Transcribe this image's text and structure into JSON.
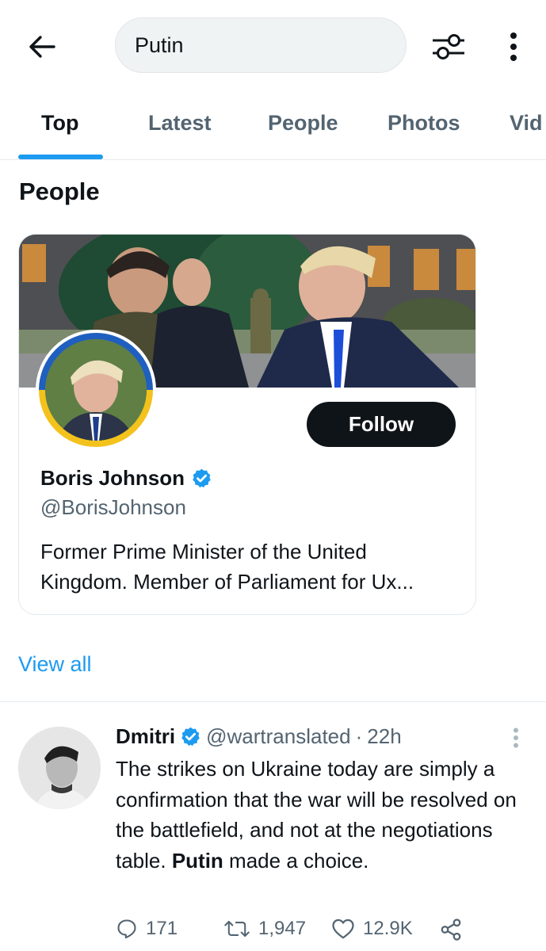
{
  "search": {
    "query": "Putin"
  },
  "tabs": [
    {
      "label": "Top",
      "active": true
    },
    {
      "label": "Latest"
    },
    {
      "label": "People"
    },
    {
      "label": "Photos"
    },
    {
      "label": "Vid"
    }
  ],
  "people_section": {
    "title": "People",
    "view_all": "View all",
    "card": {
      "name": "Boris Johnson",
      "verified": true,
      "handle": "@BorisJohnson",
      "bio_line1": "Former Prime Minister of the United",
      "bio_line2": "Kingdom. Member of Parliament for Ux...",
      "follow_label": "Follow"
    }
  },
  "tweet": {
    "name": "Dmitri",
    "verified": true,
    "handle": "@wartranslated",
    "separator": "·",
    "time": "22h",
    "text_before": "The strikes on Ukraine today are simply a confirmation that the war will be resolved on the battlefield, and not at the negotiations table. ",
    "text_bold": "Putin",
    "text_after": " made a choice.",
    "replies": "171",
    "retweets": "1,947",
    "likes": "12.9K"
  },
  "colors": {
    "accent": "#1d9bf0",
    "text_primary": "#0f1419",
    "text_secondary": "#536471",
    "follow_bg": "#0f1419"
  }
}
